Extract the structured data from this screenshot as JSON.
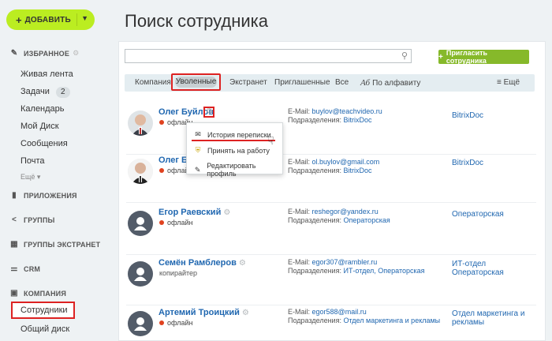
{
  "sidebar": {
    "add_label": "ДОБАВИТЬ",
    "favorites": "ИЗБРАННОЕ",
    "items": [
      "Живая лента",
      "Задачи",
      "Календарь",
      "Мой Диск",
      "Сообщения",
      "Почта"
    ],
    "tasks_count": "2",
    "more": "Ещё",
    "apps": "ПРИЛОЖЕНИЯ",
    "groups": "ГРУППЫ",
    "extranet_groups": "ГРУППЫ ЭКСТРАНЕТ",
    "crm": "CRM",
    "company": "КОМПАНИЯ",
    "employees": "Сотрудники",
    "shared_disk": "Общий диск"
  },
  "main": {
    "title": "Поиск сотрудника",
    "search_placeholder": "",
    "invite_label": "Пригласить сотрудника",
    "tabs": [
      "Компания",
      "Уволенные",
      "Экстранет",
      "Приглашенные",
      "Все",
      "По алфавиту",
      "Ещё"
    ],
    "alpha_icon": "Аб"
  },
  "employees": [
    {
      "name": "Олег Буйлов",
      "status": "офлайн",
      "position": "",
      "email_label": "E-Mail:",
      "email": "buylov@teachvideo.ru",
      "dept_label": "Подразделения:",
      "dept": "BitrixDoc",
      "org": "BitrixDoc"
    },
    {
      "name": "Олег Буй",
      "status": "офлайн",
      "position": "",
      "email_label": "E-Mail:",
      "email": "ol.buylov@gmail.com",
      "dept_label": "Подразделения:",
      "dept": "BitrixDoc",
      "org": "BitrixDoc"
    },
    {
      "name": "Егор Раевский",
      "status": "офлайн",
      "position": "",
      "email_label": "E-Mail:",
      "email": "reshegor@yandex.ru",
      "dept_label": "Подразделения:",
      "dept": "Операторская",
      "org": "Операторская"
    },
    {
      "name": "Семён Рамблеров",
      "status": "",
      "position": "копирайтер",
      "email_label": "E-Mail:",
      "email": "egor307@rambler.ru",
      "dept_label": "Подразделения:",
      "dept": "ИТ-отдел, Операторская",
      "org": "ИТ-отдел",
      "org2": "Операторская"
    },
    {
      "name": "Артемий Троицкий",
      "status": "офлайн",
      "position": "",
      "email_label": "E-Mail:",
      "email": "egor588@mail.ru",
      "dept_label": "Подразделения:",
      "dept": "Отдел маркетинга и рекламы",
      "org": "Отдел маркетинга и",
      "org2": "рекламы"
    }
  ],
  "popup": {
    "items": [
      "История переписки",
      "Принять на работу",
      "Редактировать профиль"
    ]
  },
  "colors": {
    "accent_green": "#bbed21",
    "link": "#2067b0",
    "highlight": "#dd2222",
    "offline_dot": "#e0421f"
  }
}
